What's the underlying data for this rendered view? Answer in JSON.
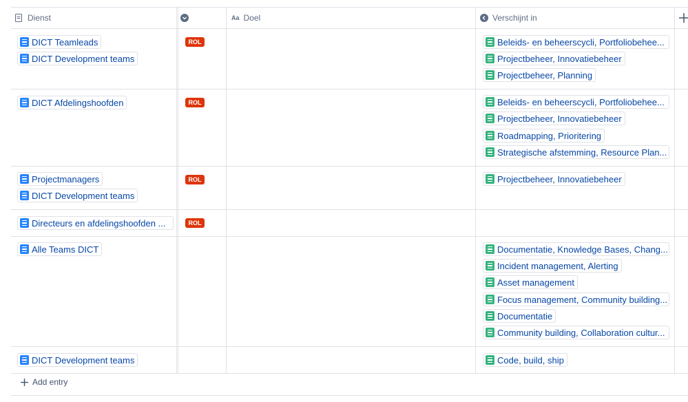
{
  "header": {
    "col_dienst": "Dienst",
    "col_doel": "Doel",
    "col_doel_prefix": "Aa",
    "col_verschijnt": "Verschijnt in"
  },
  "rows": [
    {
      "dienst": [
        "DICT Teamleads",
        "DICT Development teams"
      ],
      "badge": "ROL",
      "verschijnt": [
        "Beleids- en beheerscycli, Portfoliobehee...",
        "Projectbeheer, Innovatiebeheer",
        "Projectbeheer, Planning"
      ]
    },
    {
      "dienst": [
        "DICT Afdelingshoofden"
      ],
      "badge": "ROL",
      "verschijnt": [
        "Beleids- en beheerscycli, Portfoliobehee...",
        "Projectbeheer, Innovatiebeheer",
        "Roadmapping, Prioritering",
        "Strategische afstemming, Resource Plan..."
      ]
    },
    {
      "dienst": [
        "Projectmanagers",
        "DICT Development teams"
      ],
      "badge": "ROL",
      "verschijnt": [
        "Projectbeheer, Innovatiebeheer"
      ]
    },
    {
      "dienst": [
        "Directeurs en afdelingshoofden ..."
      ],
      "badge": "ROL",
      "verschijnt": []
    },
    {
      "dienst": [
        "Alle Teams DICT"
      ],
      "badge": "",
      "verschijnt": [
        "Documentatie, Knowledge Bases, Chang...",
        "Incident management, Alerting",
        "Asset management",
        "Focus management, Community building...",
        "Documentatie",
        "Community building, Collaboration cultur..."
      ]
    },
    {
      "dienst": [
        "DICT Development teams"
      ],
      "badge": "",
      "verschijnt": [
        "Code, build, ship"
      ]
    }
  ],
  "add_entry": "Add entry",
  "colors": {
    "badge": "#de350b",
    "link": "#0747a6",
    "page_icon": "#2684ff",
    "db_icon": "#36b37e"
  }
}
